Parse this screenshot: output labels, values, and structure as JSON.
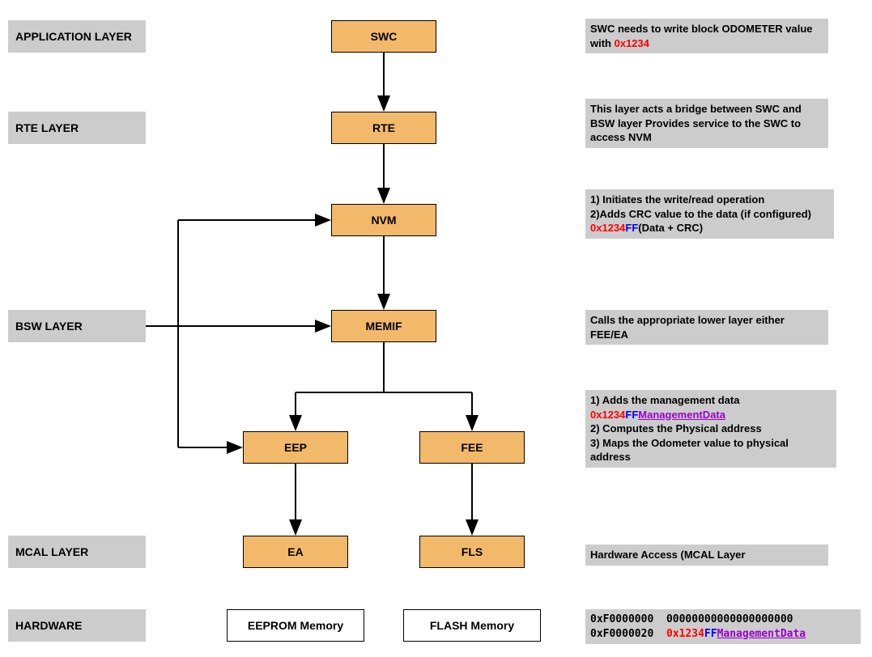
{
  "layers": {
    "application": "APPLICATION LAYER",
    "rte": "RTE LAYER",
    "bsw": "BSW LAYER",
    "mcal": "MCAL LAYER",
    "hardware": "HARDWARE"
  },
  "blocks": {
    "swc": "SWC",
    "rte": "RTE",
    "nvm": "NVM",
    "memif": "MEMIF",
    "eep": "EEP",
    "fee": "FEE",
    "ea": "EA",
    "fls": "FLS",
    "eeprom": "EEPROM Memory",
    "flash": "FLASH Memory"
  },
  "notes": {
    "swc_a": "SWC needs to write block ODOMETER value with ",
    "swc_hex": "0x1234",
    "rte": "This layer acts a bridge between SWC and BSW layer Provides service to the SWC to access NVM",
    "nvm_a": "1) Initiates the write/read operation",
    "nvm_b": "2)Adds CRC value to the data (if configured) ",
    "nvm_hex": "0x1234",
    "nvm_ff": "FF",
    "nvm_c": "(Data + CRC)",
    "memif": "Calls the appropriate lower layer either FEE/EA",
    "fee_a": "1) Adds the management data ",
    "fee_hex": "0x1234",
    "fee_ff": "FF",
    "fee_mgmt": "ManagementData",
    "fee_b": "2) Computes the Physical address",
    "fee_c": "3) Maps the Odometer value to physical address",
    "mcal": "Hardware Access (MCAL Layer",
    "hw_addr1": "0xF0000000",
    "hw_zeros": "00000000000000000000",
    "hw_addr2": "0xF0000020",
    "hw_hex": "0x1234",
    "hw_ff": "FF",
    "hw_mgmt": "ManagementData"
  }
}
